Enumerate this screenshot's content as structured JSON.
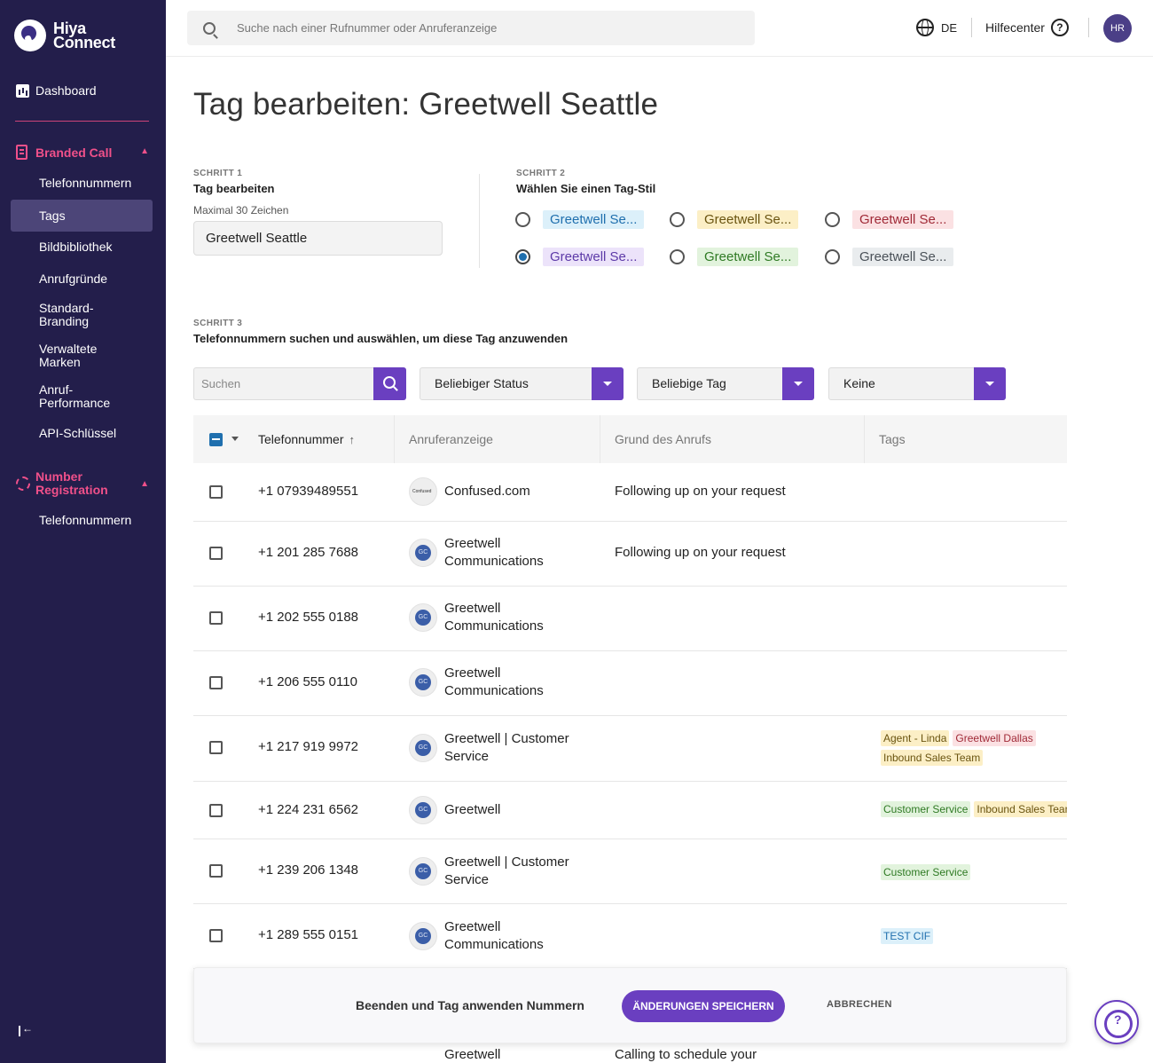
{
  "app": {
    "logo_line1": "Hiya",
    "logo_line2": "Connect"
  },
  "sidebar": {
    "dashboard": "Dashboard",
    "branded_call": "Branded Call",
    "branded_items": [
      "Telefonnummern",
      "Tags",
      "Bildbibliothek",
      "Anrufgründe",
      "Standard-Branding",
      "Verwaltete Marken",
      "Anruf-Performance",
      "API-Schlüssel"
    ],
    "number_registration": "Number Registration",
    "number_items": [
      "Telefonnummern"
    ],
    "active_item": "Tags"
  },
  "topbar": {
    "search_placeholder": "Suche nach einer Rufnummer oder Anruferanzeige",
    "language": "DE",
    "help": "Hilfecenter",
    "avatar_initials": "HR"
  },
  "page": {
    "title": "Tag bearbeiten: Greetwell Seattle"
  },
  "step1": {
    "label": "SCHRITT 1",
    "title": "Tag bearbeiten",
    "hint": "Maximal 30 Zeichen",
    "value": "Greetwell Seattle"
  },
  "step2": {
    "label": "SCHRITT 2",
    "title": "Wählen Sie einen Tag-Stil",
    "options": [
      {
        "text": "Greetwell Se...",
        "bg": "#dcf0fa",
        "fg": "#1f6fae",
        "checked": false
      },
      {
        "text": "Greetwell Se...",
        "bg": "#fcefc6",
        "fg": "#6a5410",
        "checked": false
      },
      {
        "text": "Greetwell Se...",
        "bg": "#fbe1e3",
        "fg": "#a02a37",
        "checked": false
      },
      {
        "text": "Greetwell Se...",
        "bg": "#ece3fa",
        "fg": "#5d3aa8",
        "checked": true
      },
      {
        "text": "Greetwell Se...",
        "bg": "#e2f3dd",
        "fg": "#2f7a24",
        "checked": false
      },
      {
        "text": "Greetwell Se...",
        "bg": "#e9ecee",
        "fg": "#4a5158",
        "checked": false
      }
    ]
  },
  "step3": {
    "label": "SCHRITT 3",
    "title": "Telefonnummern suchen und auswählen, um diese Tag anzuwenden",
    "search_placeholder": "Suchen",
    "status_filter": "Beliebiger Status",
    "tag_filter": "Beliebige Tag",
    "third_filter": "Keine"
  },
  "table": {
    "columns": [
      "Telefonnummer",
      "Anruferanzeige",
      "Grund des Anrufs",
      "Tags"
    ],
    "rows": [
      {
        "phone": "+1 07939489551",
        "caller": "Confused.com",
        "logo": "cf",
        "reason": "Following up on your request",
        "tags": []
      },
      {
        "phone": "+1 201 285 7688",
        "caller": "Greetwell Communications",
        "logo": "gc",
        "reason": "Following up on your request",
        "tags": []
      },
      {
        "phone": "+1 202 555 0188",
        "caller": "Greetwell Communications",
        "logo": "gc",
        "reason": "",
        "tags": []
      },
      {
        "phone": "+1 206 555 0110",
        "caller": "Greetwell Communications",
        "logo": "gc",
        "reason": "",
        "tags": []
      },
      {
        "phone": "+1 217 919 9972",
        "caller": "Greetwell | Customer Service",
        "logo": "gc",
        "reason": "",
        "tags": [
          {
            "text": "Agent - Linda",
            "color": "yellow"
          },
          {
            "text": "Greetwell Dallas",
            "color": "red"
          },
          {
            "text": "Inbound Sales Team",
            "color": "yellow"
          }
        ]
      },
      {
        "phone": "+1 224 231 6562",
        "caller": "Greetwell",
        "logo": "gc",
        "reason": "",
        "tags": [
          {
            "text": "Customer Service",
            "color": "green"
          },
          {
            "text": "Inbound Sales Team",
            "color": "yellow"
          }
        ]
      },
      {
        "phone": "+1 239 206 1348",
        "caller": "Greetwell | Customer Service",
        "logo": "gc",
        "reason": "",
        "tags": [
          {
            "text": "Customer Service",
            "color": "green"
          }
        ]
      },
      {
        "phone": "+1 289 555 0151",
        "caller": "Greetwell Communications",
        "logo": "gc",
        "reason": "",
        "tags": [
          {
            "text": "TEST CIF",
            "color": "blue"
          }
        ]
      }
    ],
    "peek_caller": "Greetwell",
    "peek_reason": "Calling to schedule your"
  },
  "footer": {
    "text": "Beenden und Tag anwenden Nummern",
    "save": "ÄNDERUNGEN SPEICHERN",
    "cancel": "ABBRECHEN"
  },
  "colors": {
    "sidebar_bg": "#231e4b",
    "accent": "#6a3fc0",
    "section_pink": "#f0508a"
  }
}
